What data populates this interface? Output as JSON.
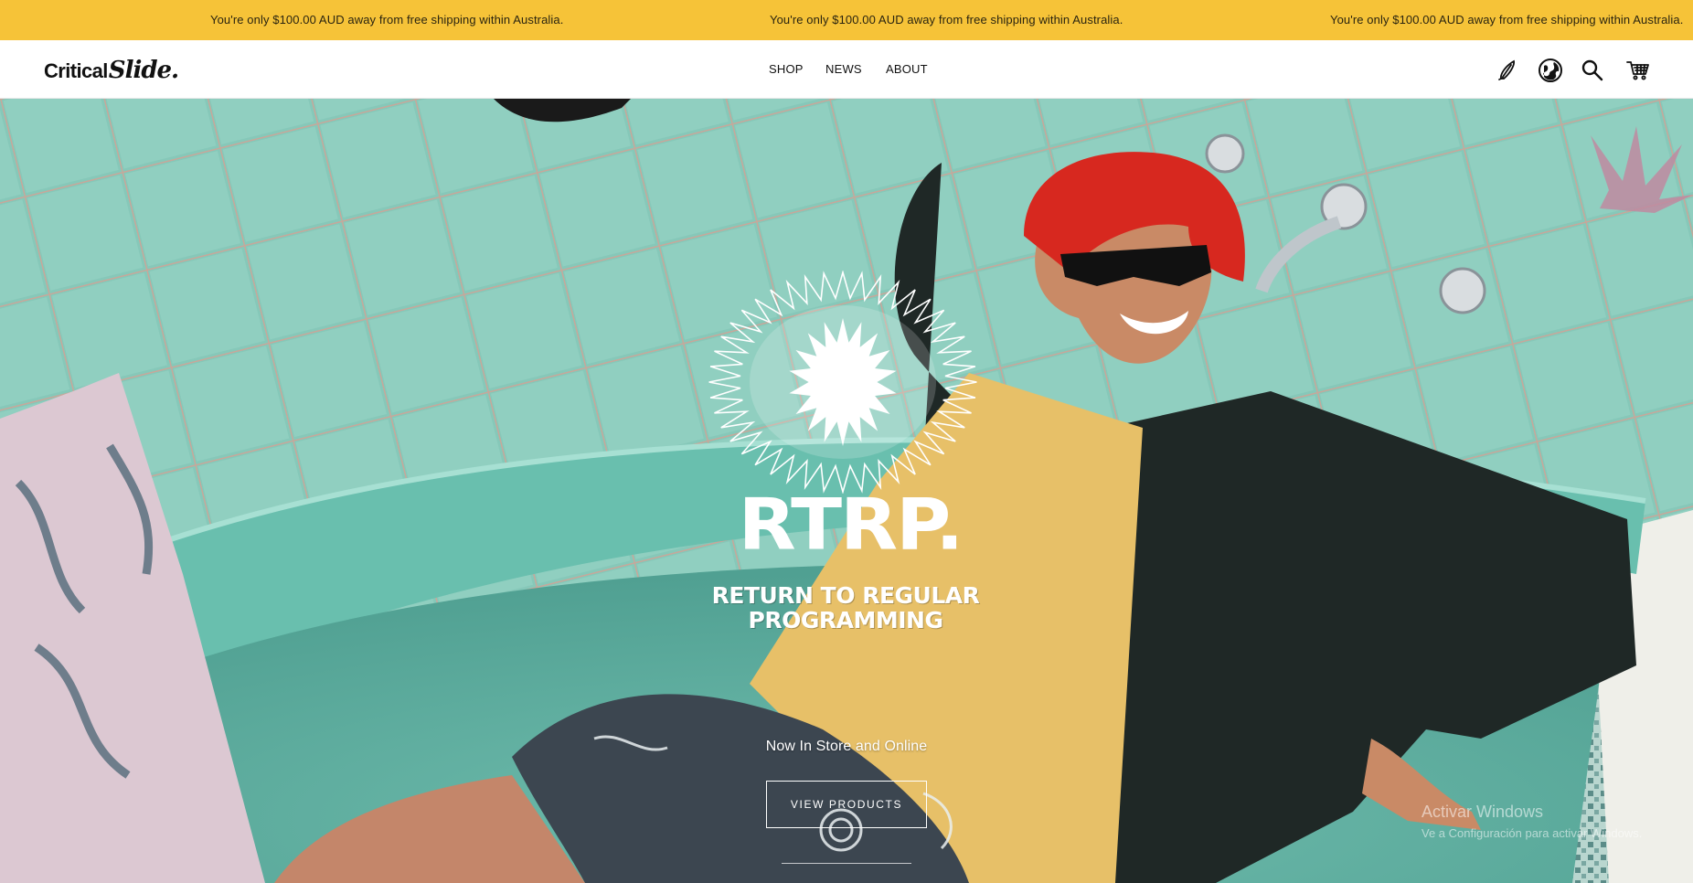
{
  "announcement": {
    "message": "You're only $100.00 AUD away from free shipping within Australia."
  },
  "header": {
    "logo": {
      "word1": "Critical",
      "word2": "Slide."
    },
    "nav": [
      {
        "label": "SHOP"
      },
      {
        "label": "NEWS"
      },
      {
        "label": "ABOUT"
      }
    ],
    "icons": [
      "surfboard-icon",
      "globe-icon",
      "search-icon",
      "cart-icon"
    ]
  },
  "hero": {
    "campaign_title": "RTRP.",
    "campaign_subtitle_line1": "RETURN TO REGULAR",
    "campaign_subtitle_line2": "PROGRAMMING",
    "tagline": "Now In Store and Online",
    "cta_label": "VIEW PRODUCTS"
  },
  "os_watermark": {
    "title": "Activar Windows",
    "subtitle": "Ve a Configuración para activar Windows."
  },
  "colors": {
    "announcement_bg": "#f6c338",
    "tile_green": "#7fc3b4",
    "hat_red": "#d7281f",
    "shirt_yellow": "#e7c068"
  }
}
